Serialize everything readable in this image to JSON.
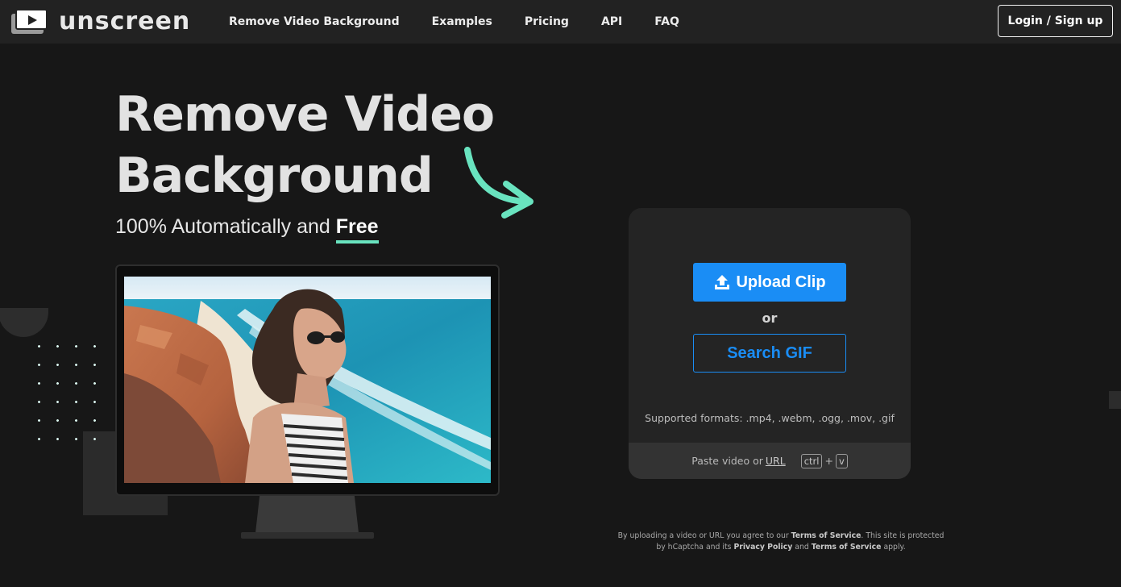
{
  "header": {
    "logo_text": "unscreen",
    "nav": [
      "Remove Video Background",
      "Examples",
      "Pricing",
      "API",
      "FAQ"
    ],
    "login_label": "Login / Sign up"
  },
  "hero": {
    "title_line1": "Remove Video",
    "title_line2": "Background",
    "subtitle_prefix": "100% Automatically and ",
    "subtitle_emphasis": "Free",
    "accent_color": "#69e3bf"
  },
  "upload": {
    "upload_label": "Upload Clip",
    "upload_icon": "upload-icon",
    "or_label": "or",
    "search_gif_label": "Search GIF",
    "formats_text": "Supported formats: .mp4, .webm, .ogg, .mov, .gif",
    "paste_prefix": "Paste video or ",
    "paste_url": "URL",
    "key_ctrl": "ctrl",
    "key_plus": "+",
    "key_v": "v",
    "button_color": "#1a8df5"
  },
  "legal": {
    "t1": "By uploading a video or URL you agree to our ",
    "terms1": "Terms of Service",
    "t2": ". This site is protected by hCaptcha and its ",
    "privacy": "Privacy Policy",
    "t3": " and ",
    "terms2": "Terms of Service",
    "t4": " apply."
  }
}
